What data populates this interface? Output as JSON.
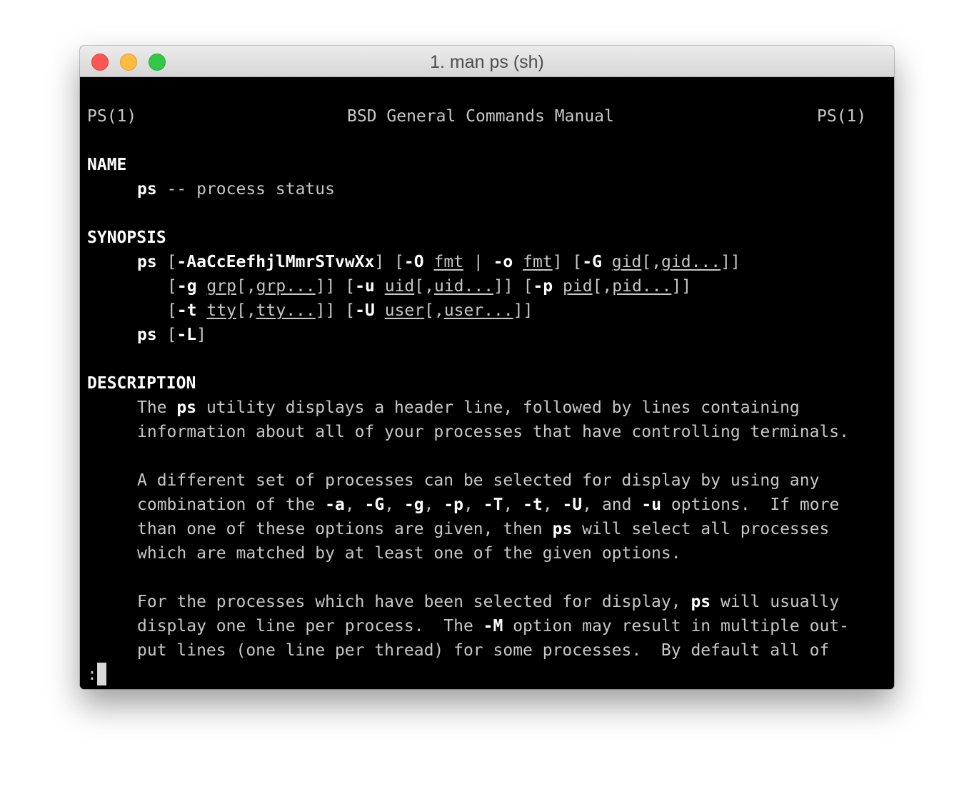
{
  "window": {
    "title": "1. man ps (sh)"
  },
  "header": {
    "left": "PS(1)",
    "center": "BSD General Commands Manual",
    "right": "PS(1)"
  },
  "sections": {
    "name": "NAME",
    "synopsis": "SYNOPSIS",
    "description": "DESCRIPTION"
  },
  "name_line": {
    "cmd": "ps",
    "rest": " -- process status"
  },
  "synopsis": {
    "ps": "ps",
    "open1": "[",
    "flags": "-AaCcEefhjlMmrSTvwXx",
    "close1": "] [",
    "opt_O": "-O",
    "fmt1": "fmt",
    "pipe": " | ",
    "opt_o": "-o",
    "fmt2": "fmt",
    "close2": "] [",
    "opt_G": "-G",
    "gid1": "gid",
    "sep_gid": "[,",
    "gid2": "gid...",
    "close_gid": "]]",
    "open_g": "[",
    "opt_g": "-g",
    "grp1": "grp",
    "sep_grp": "[,",
    "grp2": "grp...",
    "close_grp": "]] [",
    "opt_u": "-u",
    "uid1": "uid",
    "sep_uid": "[,",
    "uid2": "uid...",
    "close_uid": "]] [",
    "opt_p": "-p",
    "pid1": "pid",
    "sep_pid": "[,",
    "pid2": "pid...",
    "close_pid": "]]",
    "open_t": "[",
    "opt_t": "-t",
    "tty1": "tty",
    "sep_tty": "[,",
    "tty2": "tty...",
    "close_tty": "]] [",
    "opt_U": "-U",
    "user1": "user",
    "sep_user": "[,",
    "user2": "user...",
    "close_user": "]]",
    "ps2": "ps",
    "open_L": "[",
    "opt_L": "-L",
    "close_L": "]"
  },
  "description": {
    "p1_l1_a": "The ",
    "p1_l1_ps": "ps",
    "p1_l1_b": " utility displays a header line, followed by lines containing",
    "p1_l2": "information about all of your processes that have controlling terminals.",
    "p2_l1": "A different set of processes can be selected for display by using any",
    "p2_l2_a": "combination of the ",
    "p2_l2_o1": "-a",
    "p2_l2_c1": ", ",
    "p2_l2_o2": "-G",
    "p2_l2_c2": ", ",
    "p2_l2_o3": "-g",
    "p2_l2_c3": ", ",
    "p2_l2_o4": "-p",
    "p2_l2_c4": ", ",
    "p2_l2_o5": "-T",
    "p2_l2_c5": ", ",
    "p2_l2_o6": "-t",
    "p2_l2_c6": ", ",
    "p2_l2_o7": "-U",
    "p2_l2_c7": ", and ",
    "p2_l2_o8": "-u",
    "p2_l2_b": " options.  If more",
    "p2_l3_a": "than one of these options are given, then ",
    "p2_l3_ps": "ps",
    "p2_l3_b": " will select all processes",
    "p2_l4": "which are matched by at least one of the given options.",
    "p3_l1_a": "For the processes which have been selected for display, ",
    "p3_l1_ps": "ps",
    "p3_l1_b": " will usually",
    "p3_l2_a": "display one line per process.  The ",
    "p3_l2_M": "-M",
    "p3_l2_b": " option may result in multiple out-",
    "p3_l3": "put lines (one line per thread) for some processes.  By default all of"
  },
  "prompt": {
    "text": ":"
  }
}
